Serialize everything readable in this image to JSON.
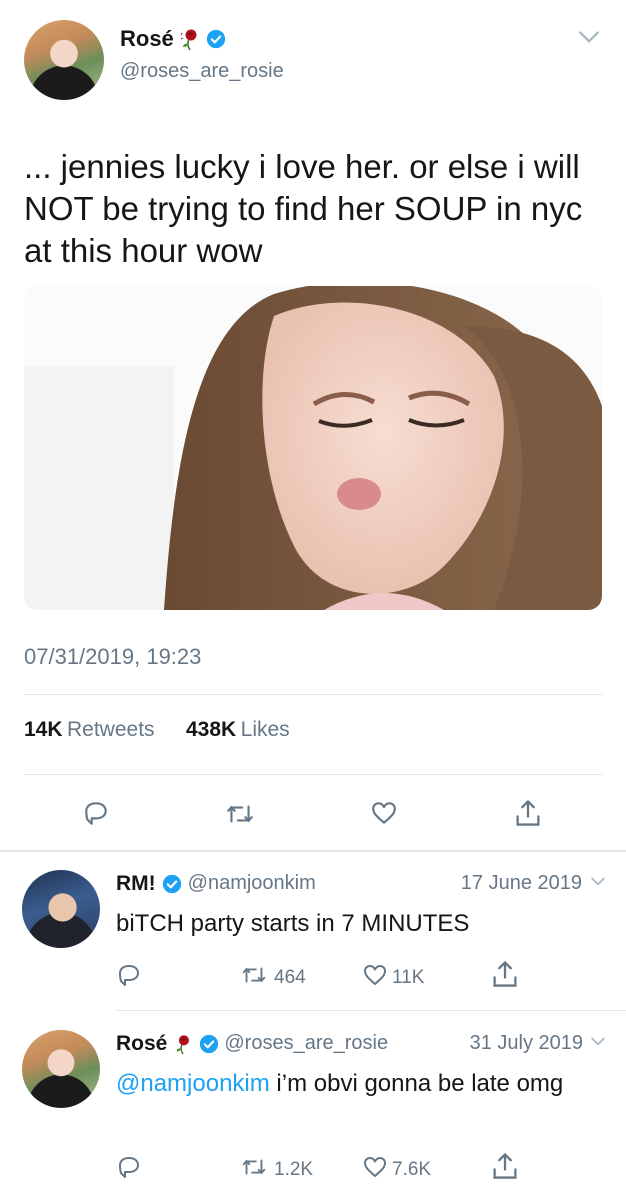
{
  "main_tweet": {
    "author_name": "Rosé",
    "author_handle": "@roses_are_rosie",
    "text": "... jennies lucky i love her. or else i will NOT be trying to find her SOUP in nyc at this hour wow",
    "timestamp": "07/31/2019, 19:23",
    "retweets_count": "14K",
    "retweets_label": "Retweets",
    "likes_count": "438K",
    "likes_label": "Likes"
  },
  "replies": [
    {
      "author_name": "RM!",
      "author_handle": "@namjoonkim",
      "date": "17 June 2019",
      "text": "biTCH party starts in 7 MINUTES",
      "retweets": "464",
      "likes": "11K"
    },
    {
      "author_name": "Rosé",
      "author_handle": "@roses_are_rosie",
      "date": "31 July 2019",
      "mention": "@namjoonkim",
      "text": " i’m obvi gonna be late omg",
      "retweets": "1.2K",
      "likes": "7.6K"
    }
  ],
  "colors": {
    "verified": "#1da1f2",
    "link": "#1da1f2",
    "muted": "#657786",
    "divider": "#e1e8ed"
  },
  "icons": [
    "chevron-down-icon",
    "verified-badge-icon",
    "rose-emoji-icon",
    "reply-icon",
    "retweet-icon",
    "like-icon",
    "share-icon"
  ]
}
